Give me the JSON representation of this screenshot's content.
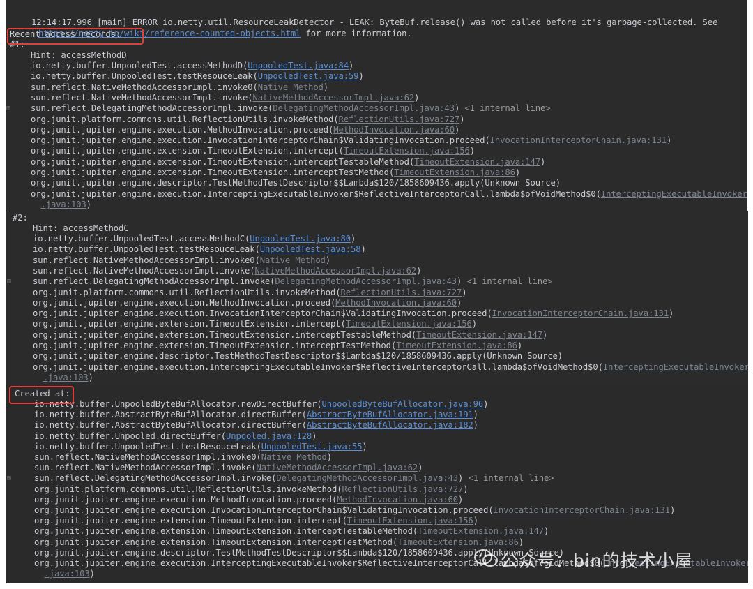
{
  "console": {
    "header_line": "12:14:17.996 [main] ERROR io.netty.util.ResourceLeakDetector - LEAK: ByteBuf.release() was not called before it's garbage-collected. See",
    "wiki_link": "https://netty.io/wiki/reference-counted-objects.html",
    "wiki_suffix": " for more information.",
    "recent_label": "Recent access records:",
    "created_label": "Created at:",
    "watermark": "公众号：bin的技术小屋"
  },
  "records": [
    {
      "label": "#1:",
      "hint": "Hint: accessMethodD",
      "frames": [
        {
          "m": "io.netty.buffer.UnpooledTest.accessMethodD(",
          "f": "UnpooledTest.java:84",
          "s": ")",
          "style": "blue"
        },
        {
          "m": "io.netty.buffer.UnpooledTest.testResouceLeak(",
          "f": "UnpooledTest.java:59",
          "s": ")",
          "style": "blue"
        },
        {
          "m": "sun.reflect.NativeMethodAccessorImpl.invoke0(",
          "f": "Native Method",
          "s": ")",
          "style": "gray"
        },
        {
          "m": "sun.reflect.NativeMethodAccessorImpl.invoke(",
          "f": "NativeMethodAccessorImpl.java:62",
          "s": ")",
          "style": "gray"
        },
        {
          "m": "sun.reflect.DelegatingMethodAccessorImpl.invoke(",
          "f": "DelegatingMethodAccessorImpl.java:43",
          "s": ") <1 internal line>",
          "style": "gray",
          "gutter": true
        },
        {
          "m": "org.junit.platform.commons.util.ReflectionUtils.invokeMethod(",
          "f": "ReflectionUtils.java:727",
          "s": ")",
          "style": "gray"
        },
        {
          "m": "org.junit.jupiter.engine.execution.MethodInvocation.proceed(",
          "f": "MethodInvocation.java:60",
          "s": ")",
          "style": "gray"
        },
        {
          "m": "org.junit.jupiter.engine.execution.InvocationInterceptorChain$ValidatingInvocation.proceed(",
          "f": "InvocationInterceptorChain.java:131",
          "s": ")",
          "style": "gray"
        },
        {
          "m": "org.junit.jupiter.engine.extension.TimeoutExtension.intercept(",
          "f": "TimeoutExtension.java:156",
          "s": ")",
          "style": "gray"
        },
        {
          "m": "org.junit.jupiter.engine.extension.TimeoutExtension.interceptTestableMethod(",
          "f": "TimeoutExtension.java:147",
          "s": ")",
          "style": "gray"
        },
        {
          "m": "org.junit.jupiter.engine.extension.TimeoutExtension.interceptTestMethod(",
          "f": "TimeoutExtension.java:86",
          "s": ")",
          "style": "gray"
        },
        {
          "m": "org.junit.jupiter.engine.descriptor.TestMethodTestDescriptor$$Lambda$120/1858609436.apply(Unknown Source)",
          "f": "",
          "s": "",
          "style": "none"
        },
        {
          "m": "org.junit.jupiter.engine.execution.InterceptingExecutableInvoker$ReflectiveInterceptorCall.lambda$ofVoidMethod$0(",
          "f": "InterceptingExecutableInvoker",
          "s": "",
          "style": "gray"
        },
        {
          "m": "  ",
          "f": ".java:103",
          "s": ")",
          "style": "gray"
        }
      ]
    },
    {
      "label": "#2:",
      "hint": "Hint: accessMethodC",
      "frames": [
        {
          "m": "io.netty.buffer.UnpooledTest.accessMethodC(",
          "f": "UnpooledTest.java:80",
          "s": ")",
          "style": "blue"
        },
        {
          "m": "io.netty.buffer.UnpooledTest.testResouceLeak(",
          "f": "UnpooledTest.java:58",
          "s": ")",
          "style": "blue"
        },
        {
          "m": "sun.reflect.NativeMethodAccessorImpl.invoke0(",
          "f": "Native Method",
          "s": ")",
          "style": "gray"
        },
        {
          "m": "sun.reflect.NativeMethodAccessorImpl.invoke(",
          "f": "NativeMethodAccessorImpl.java:62",
          "s": ")",
          "style": "gray"
        },
        {
          "m": "sun.reflect.DelegatingMethodAccessorImpl.invoke(",
          "f": "DelegatingMethodAccessorImpl.java:43",
          "s": ") <1 internal line>",
          "style": "gray",
          "gutter": true
        },
        {
          "m": "org.junit.platform.commons.util.ReflectionUtils.invokeMethod(",
          "f": "ReflectionUtils.java:727",
          "s": ")",
          "style": "gray"
        },
        {
          "m": "org.junit.jupiter.engine.execution.MethodInvocation.proceed(",
          "f": "MethodInvocation.java:60",
          "s": ")",
          "style": "gray"
        },
        {
          "m": "org.junit.jupiter.engine.execution.InvocationInterceptorChain$ValidatingInvocation.proceed(",
          "f": "InvocationInterceptorChain.java:131",
          "s": ")",
          "style": "gray"
        },
        {
          "m": "org.junit.jupiter.engine.extension.TimeoutExtension.intercept(",
          "f": "TimeoutExtension.java:156",
          "s": ")",
          "style": "gray"
        },
        {
          "m": "org.junit.jupiter.engine.extension.TimeoutExtension.interceptTestableMethod(",
          "f": "TimeoutExtension.java:147",
          "s": ")",
          "style": "gray"
        },
        {
          "m": "org.junit.jupiter.engine.extension.TimeoutExtension.interceptTestMethod(",
          "f": "TimeoutExtension.java:86",
          "s": ")",
          "style": "gray"
        },
        {
          "m": "org.junit.jupiter.engine.descriptor.TestMethodTestDescriptor$$Lambda$120/1858609436.apply(Unknown Source)",
          "f": "",
          "s": "",
          "style": "none"
        },
        {
          "m": "org.junit.jupiter.engine.execution.InterceptingExecutableInvoker$ReflectiveInterceptorCall.lambda$ofVoidMethod$0(",
          "f": "InterceptingExecutableInvoker",
          "s": "",
          "style": "gray"
        },
        {
          "m": "  ",
          "f": ".java:103",
          "s": ")",
          "style": "gray"
        }
      ]
    }
  ],
  "created": {
    "frames": [
      {
        "m": "io.netty.buffer.UnpooledByteBufAllocator.newDirectBuffer(",
        "f": "UnpooledByteBufAllocator.java:96",
        "s": ")",
        "style": "blue"
      },
      {
        "m": "io.netty.buffer.AbstractByteBufAllocator.directBuffer(",
        "f": "AbstractByteBufAllocator.java:191",
        "s": ")",
        "style": "blue"
      },
      {
        "m": "io.netty.buffer.AbstractByteBufAllocator.directBuffer(",
        "f": "AbstractByteBufAllocator.java:182",
        "s": ")",
        "style": "blue"
      },
      {
        "m": "io.netty.buffer.Unpooled.directBuffer(",
        "f": "Unpooled.java:128",
        "s": ")",
        "style": "blue"
      },
      {
        "m": "io.netty.buffer.UnpooledTest.testResouceLeak(",
        "f": "UnpooledTest.java:55",
        "s": ")",
        "style": "blue"
      },
      {
        "m": "sun.reflect.NativeMethodAccessorImpl.invoke0(",
        "f": "Native Method",
        "s": ")",
        "style": "gray"
      },
      {
        "m": "sun.reflect.NativeMethodAccessorImpl.invoke(",
        "f": "NativeMethodAccessorImpl.java:62",
        "s": ")",
        "style": "gray"
      },
      {
        "m": "sun.reflect.DelegatingMethodAccessorImpl.invoke(",
        "f": "DelegatingMethodAccessorImpl.java:43",
        "s": ") <1 internal line>",
        "style": "gray",
        "gutter": true
      },
      {
        "m": "org.junit.platform.commons.util.ReflectionUtils.invokeMethod(",
        "f": "ReflectionUtils.java:727",
        "s": ")",
        "style": "gray"
      },
      {
        "m": "org.junit.jupiter.engine.execution.MethodInvocation.proceed(",
        "f": "MethodInvocation.java:60",
        "s": ")",
        "style": "gray"
      },
      {
        "m": "org.junit.jupiter.engine.execution.InvocationInterceptorChain$ValidatingInvocation.proceed(",
        "f": "InvocationInterceptorChain.java:131",
        "s": ")",
        "style": "gray"
      },
      {
        "m": "org.junit.jupiter.engine.extension.TimeoutExtension.intercept(",
        "f": "TimeoutExtension.java:156",
        "s": ")",
        "style": "gray"
      },
      {
        "m": "org.junit.jupiter.engine.extension.TimeoutExtension.interceptTestableMethod(",
        "f": "TimeoutExtension.java:147",
        "s": ")",
        "style": "gray"
      },
      {
        "m": "org.junit.jupiter.engine.extension.TimeoutExtension.interceptTestMethod(",
        "f": "TimeoutExtension.java:86",
        "s": ")",
        "style": "gray"
      },
      {
        "m": "org.junit.jupiter.engine.descriptor.TestMethodTestDescriptor$$Lambda$120/1858609436.apply(Unknown Source)",
        "f": "",
        "s": "",
        "style": "none"
      },
      {
        "m": "org.junit.jupiter.engine.execution.InterceptingExecutableInvoker$ReflectiveInterceptorCall.lambda$ofVoidMethod$0(",
        "f": "InterceptingExecutableInvoker",
        "s": "",
        "style": "gray"
      },
      {
        "m": "  ",
        "f": ".java:103",
        "s": ")",
        "style": "gray"
      }
    ]
  }
}
